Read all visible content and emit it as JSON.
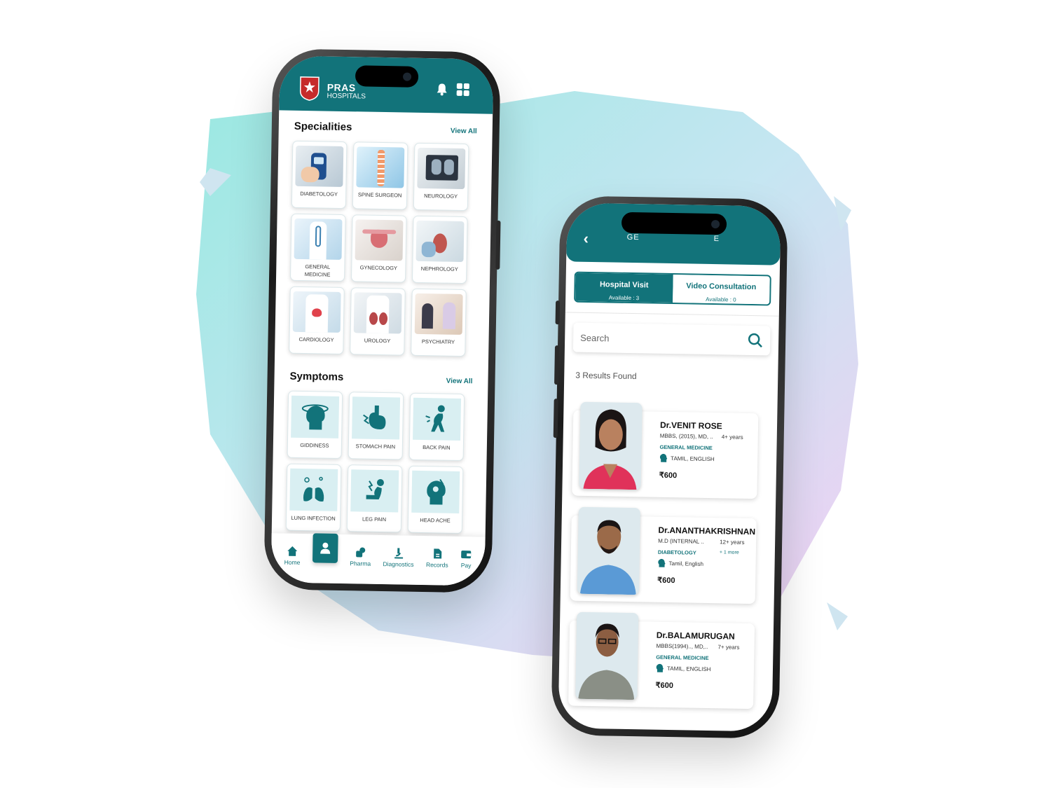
{
  "colors": {
    "primary": "#12737a",
    "accent_light": "#d9eff2"
  },
  "left_app": {
    "brand": {
      "name": "PRAS",
      "sub": "HOSPITALS"
    },
    "header_icons": [
      "bell-icon",
      "grid-icon"
    ],
    "specialities": {
      "title": "Specialities",
      "view_all": "View All",
      "items": [
        {
          "label": "DIABETOLOGY",
          "icon": "glucometer-photo"
        },
        {
          "label": "SPINE SURGEON",
          "icon": "spine-photo"
        },
        {
          "label": "NEUROLOGY",
          "icon": "xray-photo"
        },
        {
          "label": "GENERAL MEDICINE",
          "icon": "doctor-photo"
        },
        {
          "label": "GYNECOLOGY",
          "icon": "uterus-photo"
        },
        {
          "label": "NEPHROLOGY",
          "icon": "kidney-model-photo"
        },
        {
          "label": "CARDIOLOGY",
          "icon": "heart-photo"
        },
        {
          "label": "UROLOGY",
          "icon": "kidney-photo"
        },
        {
          "label": "PSYCHIATRY",
          "icon": "counselling-photo"
        }
      ]
    },
    "symptoms": {
      "title": "Symptoms",
      "view_all": "View All",
      "items": [
        {
          "label": "GIDDINESS",
          "icon": "dizzy-head-icon"
        },
        {
          "label": "STOMACH PAIN",
          "icon": "stomach-icon"
        },
        {
          "label": "BACK PAIN",
          "icon": "back-pain-icon"
        },
        {
          "label": "LUNG INFECTION",
          "icon": "lungs-icon"
        },
        {
          "label": "LEG PAIN",
          "icon": "leg-pain-icon"
        },
        {
          "label": "HEAD ACHE",
          "icon": "headache-icon"
        }
      ]
    },
    "nav": [
      {
        "label": "Home",
        "icon": "home-icon"
      },
      {
        "label": "",
        "icon": "doctor-icon"
      },
      {
        "label": "Pharma",
        "icon": "pharma-icon"
      },
      {
        "label": "Diagnostics",
        "icon": "microscope-icon"
      },
      {
        "label": "Records",
        "icon": "records-icon"
      },
      {
        "label": "Pay",
        "icon": "wallet-icon"
      }
    ]
  },
  "right_app": {
    "header_title_left": "GE",
    "header_title_right": "E",
    "tabs": [
      {
        "label": "Hospital Visit",
        "sub": "Available : 3"
      },
      {
        "label": "Video Consultation",
        "sub": "Available : 0"
      }
    ],
    "search": {
      "placeholder": "Search"
    },
    "results": "3  Results Found",
    "doctors": [
      {
        "name": "Dr.VENIT ROSE",
        "qual": "MBBS, (2015), MD, ..",
        "exp": "4+ years",
        "more": "",
        "spec": "GENERAL MEDICINE",
        "lang": "TAMIL, ENGLISH",
        "fee": "600"
      },
      {
        "name": "Dr.ANANTHAKRISHNAN",
        "qual": "M.D (INTERNAL ..",
        "exp": "12+ years",
        "more": "+ 1 more",
        "spec": "DIABETOLOGY",
        "lang": "Tamil, English",
        "fee": "600"
      },
      {
        "name": "Dr.BALAMURUGAN",
        "qual": "MBBS(1994).., MD,..",
        "exp": "7+ years",
        "more": "",
        "spec": "GENERAL MEDICINE",
        "lang": "TAMIL, ENGLISH",
        "fee": "600"
      }
    ],
    "currency": "₹"
  }
}
